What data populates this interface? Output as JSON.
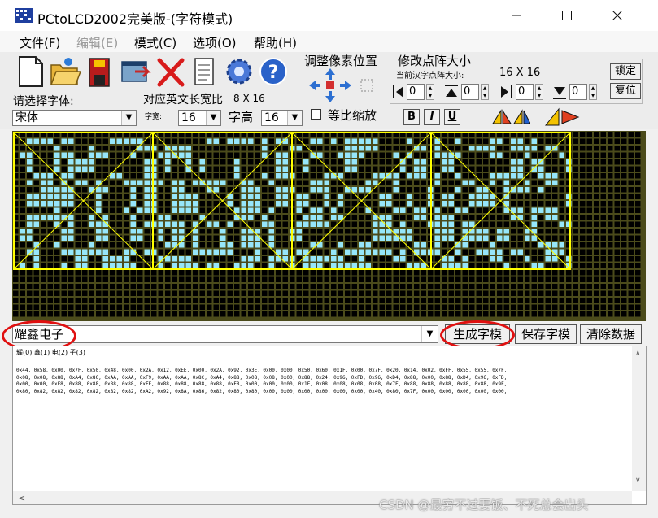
{
  "window": {
    "title": "PCtoLCD2002完美版-(字符模式)"
  },
  "menu": [
    {
      "label": "文件(F)",
      "disabled": false
    },
    {
      "label": "编辑(E)",
      "disabled": true
    },
    {
      "label": "模式(C)",
      "disabled": false
    },
    {
      "label": "选项(O)",
      "disabled": false
    },
    {
      "label": "帮助(H)",
      "disabled": false
    }
  ],
  "toolbar": {
    "adjust_title": "调整像素位置",
    "dot_title": "修改点阵大小",
    "current_size_label": "当前汉字点阵大小:",
    "current_size_value": "16 X 16",
    "lock_label": "锁定",
    "reset_label": "复位",
    "spin_values": [
      "0",
      "0",
      "0",
      "0"
    ],
    "font_label": "请选择字体:",
    "font_value": "宋体",
    "en_width_label": "对应英文长宽比",
    "en_width_value": "8 X 16",
    "width_label": "字宽:",
    "width_value": "16",
    "height_label": "字高",
    "height_value": "16",
    "scale_label": "等比缩放",
    "bold_label": "B",
    "italic_label": "I",
    "underline_label": "U"
  },
  "matrix": {
    "on_color": "#96e6fa",
    "off_color": "#000000",
    "background": "#4b4b1b",
    "frame_color": "#ffff00",
    "characters": [
      "耀",
      "鑫",
      "电",
      "子"
    ],
    "rows_on": {
      "0": [
        [
          1,
          16,
          29,
          38,
          51,
          54,
          61,
          64,
          72,
          80,
          85,
          102
        ],
        [
          3,
          7,
          11,
          18,
          22,
          25,
          29,
          32,
          36,
          40,
          46,
          62,
          72,
          75,
          84,
          98,
          104,
          106,
          110,
          115
        ],
        [
          4,
          7,
          17,
          25,
          29,
          39,
          43,
          46,
          52,
          54,
          61,
          65,
          70,
          78,
          79,
          84,
          97,
          112
        ],
        [
          10,
          17,
          24,
          42,
          49,
          57,
          62,
          69,
          76,
          81,
          87,
          92,
          96,
          109,
          111,
          112
        ],
        [
          0,
          10,
          13,
          16,
          19,
          25,
          29,
          38,
          45,
          49,
          53,
          71,
          83,
          101,
          111
        ]
      ]
    }
  },
  "bottom": {
    "text_value": "耀鑫电子",
    "generate_label": "生成字模",
    "save_label": "保存字模",
    "clear_label": "清除数据"
  },
  "output": {
    "header": "耀(0) 鑫(1) 电(2) 子(3)",
    "lines": [
      "0x44, 0x58, 0x00, 0x7F, 0x50, 0x48, 0x00, 0x2A, 0x12, 0xEE, 0x00, 0x2A, 0x92, 0x3E, 0x00, 0x00, 0x50, 0x60, 0x1F, 0x00, 0x7F, 0x20, 0x14, 0x02, 0xFF, 0x55, 0x55, 0x7F,",
      "0x08, 0x08, 0x88, 0xA4, 0x8C, 0xAA, 0xAA, 0xF9, 0xAA, 0xAA, 0x8C, 0xA4, 0x88, 0x08, 0x08, 0x00, 0x88, 0x24, 0x96, 0xFD, 0x96, 0xD4, 0x88, 0x00, 0x88, 0xD4, 0x96, 0xFD,",
      "0x00, 0x00, 0xF8, 0x88, 0x88, 0x88, 0x88, 0xFF, 0x88, 0x88, 0x88, 0x88, 0xF8, 0x00, 0x00, 0x00, 0x1F, 0x08, 0x08, 0x08, 0x08, 0x7F, 0x88, 0x88, 0x88, 0x88, 0x88, 0x9F,",
      "0x80, 0x82, 0x82, 0x82, 0x82, 0x82, 0x82, 0xA2, 0x92, 0x8A, 0x86, 0x82, 0x80, 0x80, 0x00, 0x00, 0x00, 0x00, 0x00, 0x00, 0x40, 0x80, 0x7F, 0x00, 0x00, 0x00, 0x00, 0x00,"
    ]
  },
  "watermark": "CSDN @最穷不过要饭、不死总会出头"
}
